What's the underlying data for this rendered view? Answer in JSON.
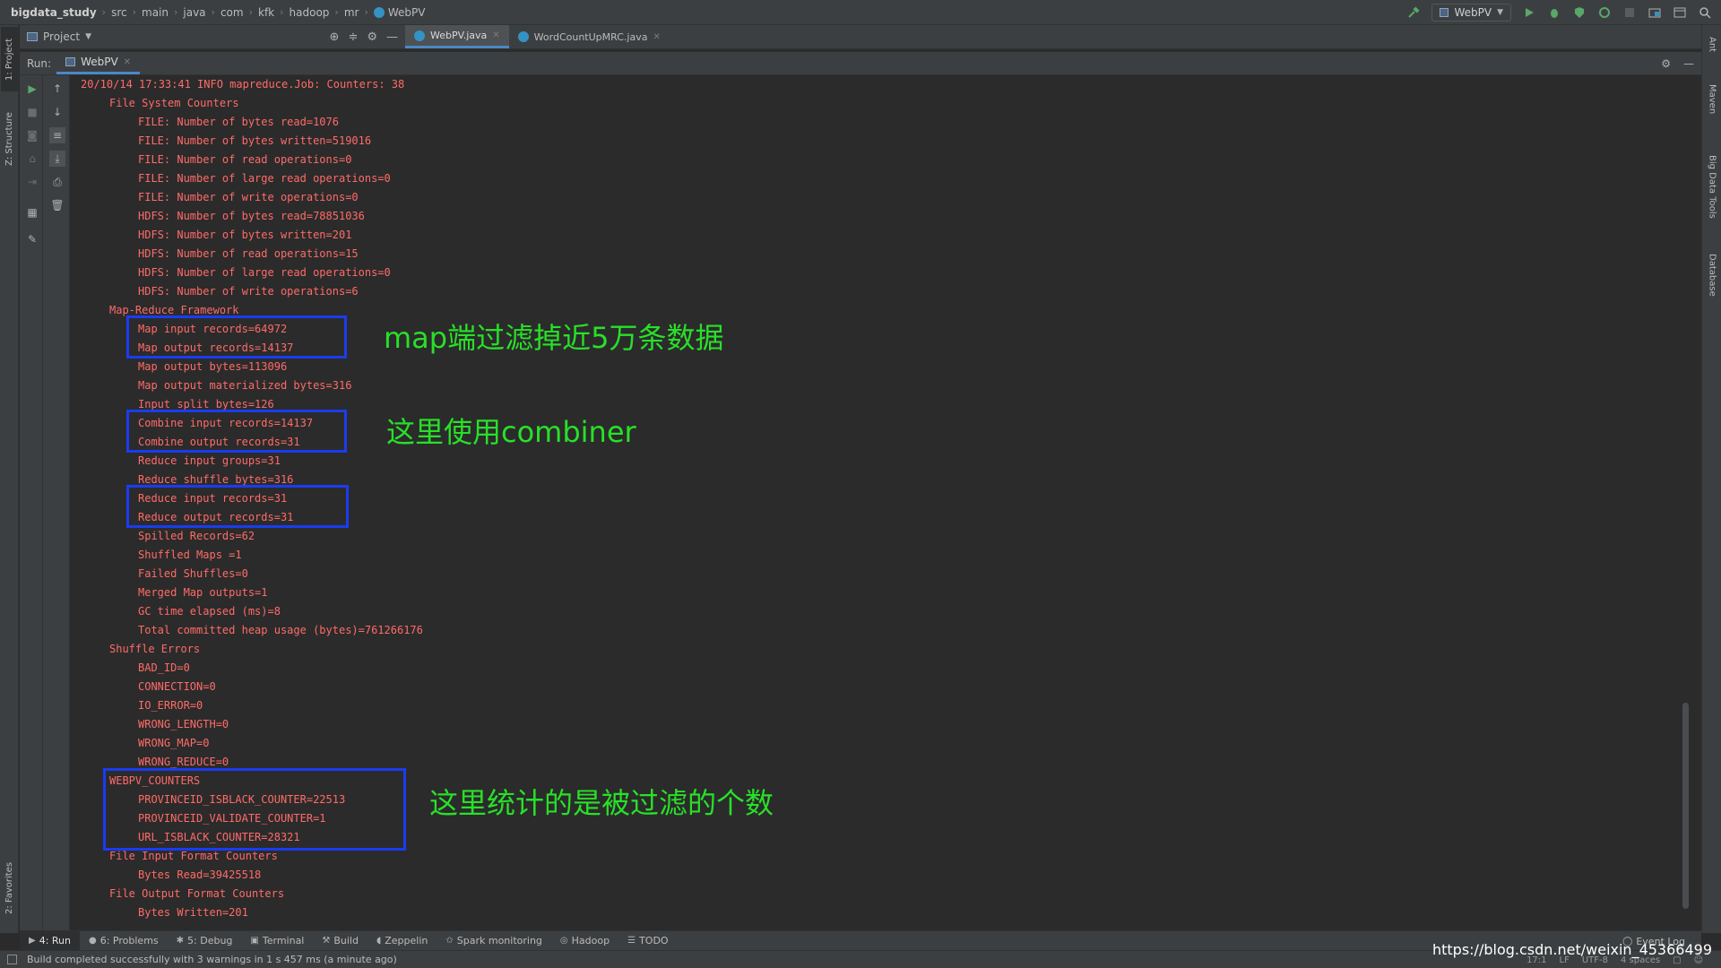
{
  "breadcrumb": {
    "items": [
      "bigdata_study",
      "src",
      "main",
      "java",
      "com",
      "kfk",
      "hadoop",
      "mr",
      "WebPV"
    ]
  },
  "run_config": {
    "label": "WebPV"
  },
  "left_strip": {
    "project": "1: Project",
    "structure": "Z: Structure",
    "favorites": "2: Favorites"
  },
  "right_strip": {
    "ant": "Ant",
    "maven": "Maven",
    "bigdata": "Big Data Tools",
    "database": "Database"
  },
  "project_panel": {
    "title": "Project"
  },
  "editor_tabs": [
    {
      "label": "WebPV.java"
    },
    {
      "label": "WordCountUpMRC.java"
    }
  ],
  "run_panel": {
    "label": "Run:",
    "tab": "WebPV"
  },
  "console_lines": [
    "20/10/14 17:33:41 INFO mapreduce.Job: Counters: 38",
    "\tFile System Counters",
    "\t\tFILE: Number of bytes read=1076",
    "\t\tFILE: Number of bytes written=519016",
    "\t\tFILE: Number of read operations=0",
    "\t\tFILE: Number of large read operations=0",
    "\t\tFILE: Number of write operations=0",
    "\t\tHDFS: Number of bytes read=78851036",
    "\t\tHDFS: Number of bytes written=201",
    "\t\tHDFS: Number of read operations=15",
    "\t\tHDFS: Number of large read operations=0",
    "\t\tHDFS: Number of write operations=6",
    "\tMap-Reduce Framework",
    "\t\tMap input records=64972",
    "\t\tMap output records=14137",
    "\t\tMap output bytes=113096",
    "\t\tMap output materialized bytes=316",
    "\t\tInput split bytes=126",
    "\t\tCombine input records=14137",
    "\t\tCombine output records=31",
    "\t\tReduce input groups=31",
    "\t\tReduce shuffle bytes=316",
    "\t\tReduce input records=31",
    "\t\tReduce output records=31",
    "\t\tSpilled Records=62",
    "\t\tShuffled Maps =1",
    "\t\tFailed Shuffles=0",
    "\t\tMerged Map outputs=1",
    "\t\tGC time elapsed (ms)=8",
    "\t\tTotal committed heap usage (bytes)=761266176",
    "\tShuffle Errors",
    "\t\tBAD_ID=0",
    "\t\tCONNECTION=0",
    "\t\tIO_ERROR=0",
    "\t\tWRONG_LENGTH=0",
    "\t\tWRONG_MAP=0",
    "\t\tWRONG_REDUCE=0",
    "\tWEBPV_COUNTERS",
    "\t\tPROVINCEID_ISBLACK_COUNTER=22513",
    "\t\tPROVINCEID_VALIDATE_COUNTER=1",
    "\t\tURL_ISBLACK_COUNTER=28321",
    "\tFile Input Format Counters",
    "\t\tBytes Read=39425518",
    "\tFile Output Format Counters",
    "\t\tBytes Written=201"
  ],
  "annotations": {
    "map_filter": "map端过滤掉近5万条数据",
    "combiner": "这里使用combiner",
    "webpv_counters": "这里统计的是被过滤的个数"
  },
  "bottom_tools": [
    {
      "label": "4: Run",
      "icon": "play-icon"
    },
    {
      "label": "6: Problems",
      "icon": "info-icon"
    },
    {
      "label": "5: Debug",
      "icon": "bug-icon"
    },
    {
      "label": "Terminal",
      "icon": "terminal-icon"
    },
    {
      "label": "Build",
      "icon": "hammer-icon"
    },
    {
      "label": "Zeppelin",
      "icon": "zeppelin-icon"
    },
    {
      "label": "Spark monitoring",
      "icon": "star-icon"
    },
    {
      "label": "Hadoop",
      "icon": "hadoop-icon"
    },
    {
      "label": "TODO",
      "icon": "list-icon"
    }
  ],
  "event_log": "Event Log",
  "status": {
    "message": "Build completed successfully with 3 warnings in 1 s 457 ms (a minute ago)",
    "position": "17:1",
    "line_sep": "LF",
    "encoding": "UTF-8",
    "indent": "4 spaces"
  },
  "watermark": "https://blog.csdn.net/weixin_45366499",
  "colors": {
    "console_text": "#ff6b68",
    "annotation": "#28e028",
    "highlight_box": "#1a3cf0",
    "accent_tab": "#4a88c7"
  }
}
